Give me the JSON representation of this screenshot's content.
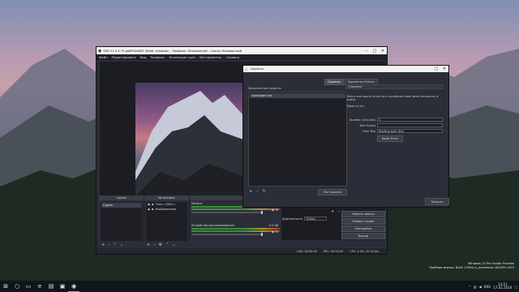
{
  "obs": {
    "title": "OBS 21.0.3-75-ga8ff1db625 (64bit, windows) - Профиль: Безымянный - Сцены: Безымянный",
    "menu": [
      "Файл",
      "Редактировать",
      "Вид",
      "Профиль",
      "Коллекция сцен",
      "Инструменты",
      "Справка"
    ],
    "docks": {
      "scenes": "Сцены",
      "sources": "Источники",
      "mixer": "Микшер"
    },
    "scenes": [
      "Сцена"
    ],
    "sources": [
      "Текст (GDI+)",
      "Изображение"
    ],
    "mixer": [
      {
        "name": "Mic/Aux",
        "db": "0.0 dB"
      },
      {
        "name": "Устройство воспроизведения",
        "db": "0.0 dB"
      }
    ],
    "transition": {
      "label": "Длительность",
      "value": "300ms"
    },
    "controls": [
      "Начать запись",
      "Режим студии",
      "Настройки",
      "Выход"
    ],
    "status": {
      "live": "LIVE: 00:00:00",
      "rec": "REC: 00:00:00",
      "cpu": "CPU: 4.4%, 30.00 fps"
    }
  },
  "dialog": {
    "title": "Скрипты",
    "tabs": [
      "Скрипты",
      "Параметры Python"
    ],
    "loaded_label": "Загруженные скрипты",
    "scripts": [
      "countdown.lua"
    ],
    "logs_button": "Лог скрипта",
    "desc_header": "Описание",
    "description": "Sets a text source to act as a countdown timer when the source is active.",
    "author": "Made by Jim",
    "props": [
      {
        "label": "Duration (minutes)",
        "value": "5"
      },
      {
        "label": "Text Source",
        "value": ""
      },
      {
        "label": "Final Text",
        "value": "Starting soon (tm)"
      }
    ],
    "reset_button": "Reset Timer",
    "close_button": "Закрыть"
  },
  "taskbar": {
    "clock": "13:21",
    "date": "17.02.2018",
    "lang": "ENG",
    "watermark": [
      "Windows 10 Pro Insider Preview",
      "Пробная версия. Build 17604.rs_prerelease.180209-1423"
    ]
  },
  "icons": [
    "windows-icon",
    "search-icon",
    "taskview-icon",
    "edge-icon",
    "explorer-icon",
    "store-icon",
    "obs-icon"
  ]
}
